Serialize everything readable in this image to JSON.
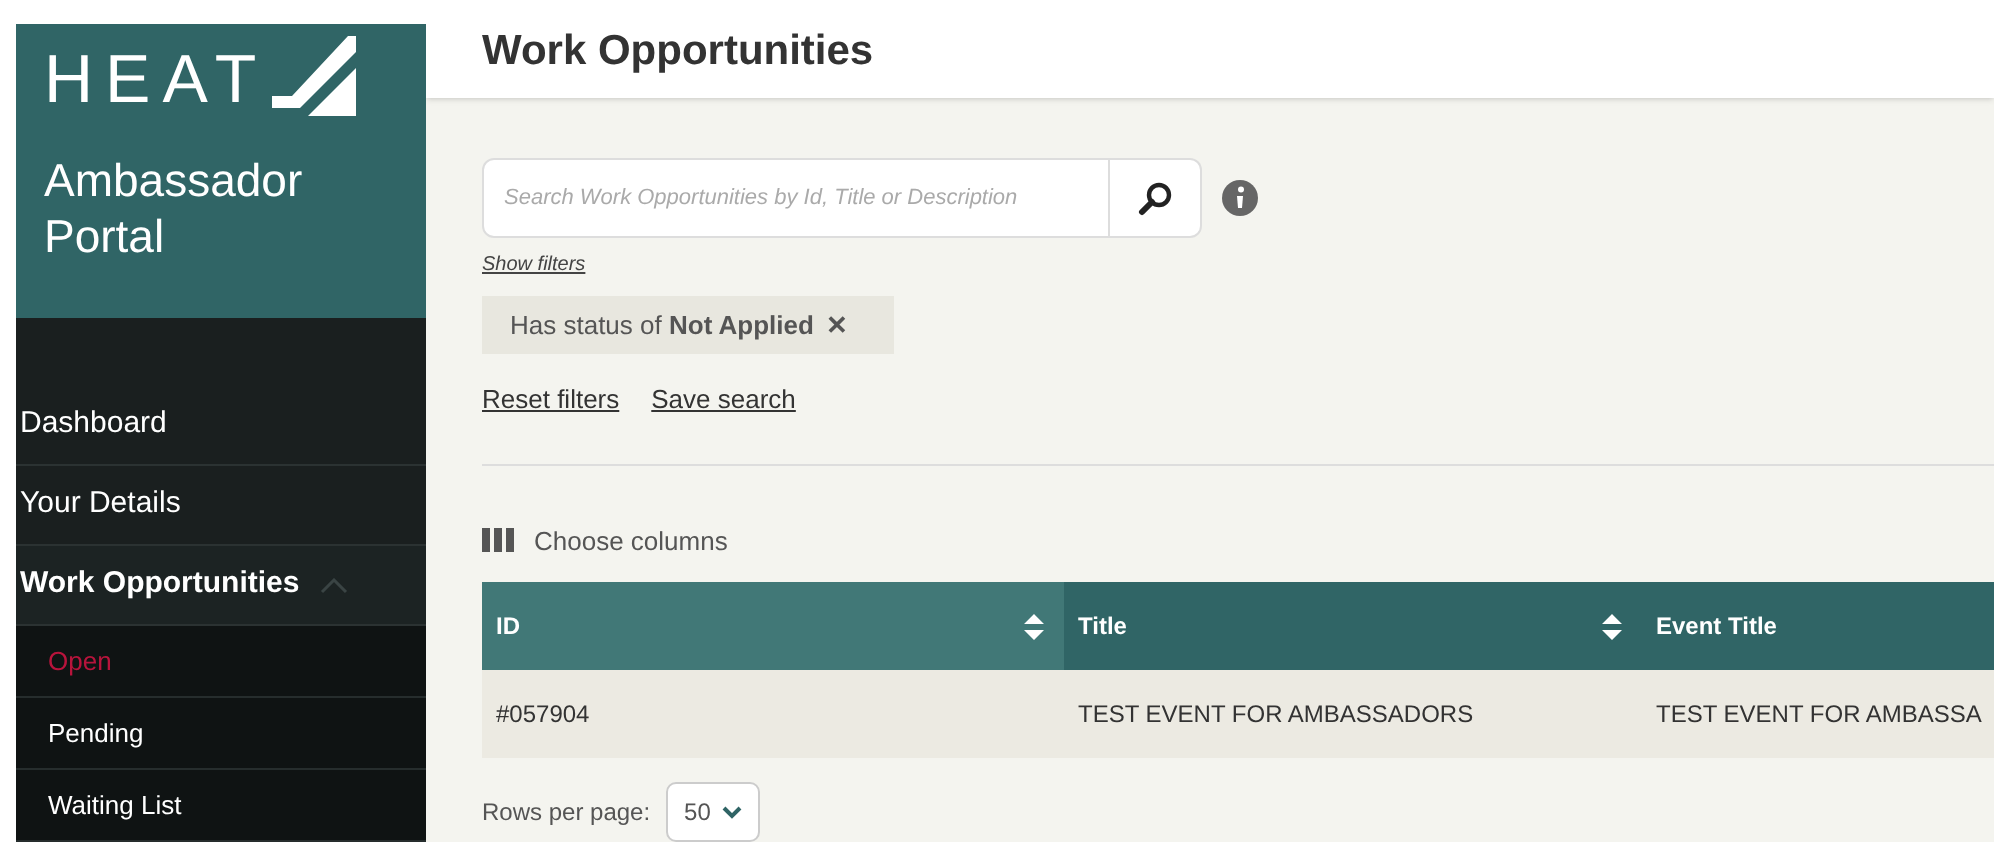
{
  "sidebar": {
    "logo": {
      "wordmark": "HEAT",
      "subtitle": "Ambassador Portal"
    },
    "items": [
      {
        "label": "Dashboard",
        "expanded": false
      },
      {
        "label": "Your Details",
        "expanded": false
      },
      {
        "label": "Work Opportunities",
        "expanded": true,
        "children": [
          {
            "label": "Open",
            "selected": true
          },
          {
            "label": "Pending",
            "selected": false
          },
          {
            "label": "Waiting List",
            "selected": false
          }
        ]
      }
    ]
  },
  "page": {
    "title": "Work Opportunities"
  },
  "search": {
    "placeholder": "Search Work Opportunities by Id, Title or Description"
  },
  "show_filters": "Show filters",
  "filter_chip": {
    "text": "Has status of **Not Applied**",
    "remove": "✕"
  },
  "links": [
    "Reset filters",
    "Save search"
  ],
  "choose_columns": "Choose columns",
  "table": {
    "columns": [
      {
        "label": "ID",
        "sorted": true,
        "sortable": true
      },
      {
        "label": "Title",
        "sorted": false,
        "sortable": true
      },
      {
        "label": "Event Title",
        "sorted": false
      }
    ],
    "rows": [
      [
        "#057904",
        "TEST EVENT FOR AMBASSADORS",
        "TEST EVENT FOR AMBASSA"
      ]
    ]
  },
  "pagination": {
    "label": "Rows per page:",
    "value": "50"
  }
}
